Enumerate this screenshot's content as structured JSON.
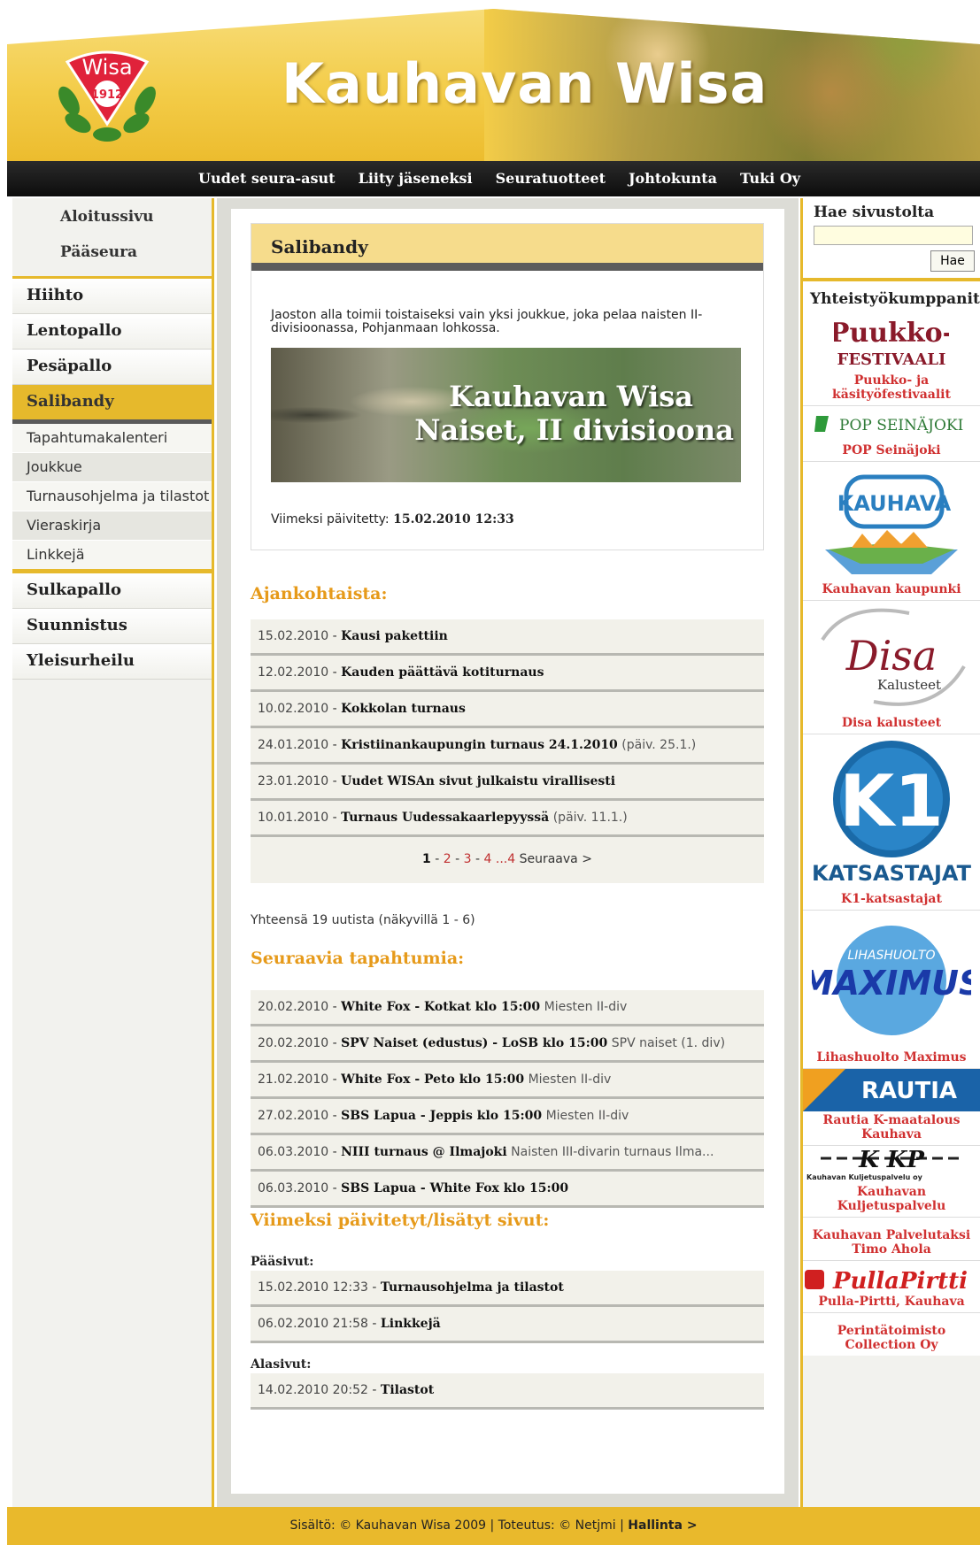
{
  "site": {
    "title": "Kauhavan Wisa",
    "logo_text": "Wisa",
    "logo_year": "1912"
  },
  "topnav": [
    "Uudet seura-asut",
    "Liity jäseneksi",
    "Seuratuotteet",
    "Johtokunta",
    "Tuki Oy"
  ],
  "left": {
    "main_links": [
      "Aloitussivu",
      "Pääseura"
    ],
    "sports_before": [
      "Hiihto",
      "Lentopallo",
      "Pesäpallo"
    ],
    "active_sport": "Salibandy",
    "subpages": [
      "Tapahtumakalenteri",
      "Joukkue",
      "Turnausohjelma ja tilastot",
      "Vieraskirja",
      "Linkkejä"
    ],
    "sports_after": [
      "Sulkapallo",
      "Suunnistus",
      "Yleisurheilu"
    ]
  },
  "main": {
    "page_title": "Salibandy",
    "intro": "Jaoston alla toimii toistaiseksi vain yksi joukkue, joka pelaa naisten II-divisioonassa, Pohjanmaan lohkossa.",
    "banner_line1": "Kauhavan Wisa",
    "banner_line2": "Naiset,  II divisioona",
    "updated_label": "Viimeksi päivitetty:",
    "updated_value": "15.02.2010 12:33",
    "news_title": "Ajankohtaista:",
    "news": [
      {
        "date": "15.02.2010",
        "title": "Kausi pakettiin",
        "extra": ""
      },
      {
        "date": "12.02.2010",
        "title": "Kauden päättävä kotiturnaus",
        "extra": ""
      },
      {
        "date": "10.02.2010",
        "title": "Kokkolan turnaus",
        "extra": ""
      },
      {
        "date": "24.01.2010",
        "title": "Kristiinankaupungin turnaus 24.1.2010",
        "extra": "(päiv. 25.1.)"
      },
      {
        "date": "23.01.2010",
        "title": "Uudet WISAn sivut julkaistu virallisesti",
        "extra": ""
      },
      {
        "date": "10.01.2010",
        "title": "Turnaus Uudessakaarlepyyssä",
        "extra": "(päiv. 11.1.)"
      }
    ],
    "pager": {
      "current": "1",
      "pages": [
        "2",
        "3",
        "4"
      ],
      "dots": "...4",
      "next": "Seuraava >"
    },
    "news_total": "Yhteensä 19 uutista (näkyvillä 1 - 6)",
    "events_title": "Seuraavia tapahtumia:",
    "events": [
      {
        "date": "20.02.2010",
        "title": "White Fox - Kotkat klo 15:00",
        "desc": "Miesten II-div"
      },
      {
        "date": "20.02.2010",
        "title": "SPV Naiset (edustus) - LoSB klo 15:00",
        "desc": "SPV naiset (1. div)"
      },
      {
        "date": "21.02.2010",
        "title": "White Fox - Peto klo 15:00",
        "desc": "Miesten II-div"
      },
      {
        "date": "27.02.2010",
        "title": "SBS Lapua - Jeppis klo 15:00",
        "desc": "Miesten II-div"
      },
      {
        "date": "06.03.2010",
        "title": "NIII turnaus @ Ilmajoki",
        "desc": "Naisten III-divarin turnaus Ilma..."
      },
      {
        "date": "06.03.2010",
        "title": "SBS Lapua - White Fox klo 15:00",
        "desc": ""
      }
    ],
    "updates_title": "Viimeksi päivitetyt/lisätyt sivut:",
    "main_pages_label": "Pääsivut:",
    "main_pages": [
      {
        "date": "15.02.2010 12:33",
        "title": "Turnausohjelma ja tilastot"
      },
      {
        "date": "06.02.2010 21:58",
        "title": "Linkkejä"
      }
    ],
    "sub_pages_label": "Alasivut:",
    "sub_pages": [
      {
        "date": "14.02.2010 20:52",
        "title": "Tilastot"
      }
    ]
  },
  "right": {
    "search_title": "Hae sivustolta",
    "search_button": "Hae",
    "partners_title": "Yhteistyökumppanit",
    "partners": [
      {
        "logo": "Puukko-Festivaali",
        "caption": "Puukko- ja käsityöfestivaalit"
      },
      {
        "logo": "POP SEINÄJOKI",
        "caption": "POP Seinäjoki"
      },
      {
        "logo": "KAUHAVA",
        "caption": "Kauhavan kaupunki"
      },
      {
        "logo": "Disa",
        "logo2": "Kalusteet",
        "caption": "Disa kalusteet"
      },
      {
        "logo": "K1",
        "logo2": "KATSASTAJAT",
        "caption": "K1-katsastajat"
      },
      {
        "logo": "MAXIMUS",
        "logo2": "LIHASHUOLTO",
        "caption": "Lihashuolto Maximus"
      },
      {
        "logo": "RAUTIA",
        "caption": "Rautia K-maatalous Kauhava"
      },
      {
        "logo": "K KP",
        "logo2": "Kauhavan Kuljetuspalvelu oy",
        "caption": "Kauhavan Kuljetuspalvelu"
      },
      {
        "logo": "",
        "caption": "Kauhavan Palvelutaksi Timo Ahola"
      },
      {
        "logo": "PullaPirtti",
        "caption": "Pulla-Pirtti, Kauhava"
      },
      {
        "logo": "",
        "caption": "Perintätoimisto Collection Oy"
      }
    ]
  },
  "footer": {
    "content": "Sisältö: © Kauhavan Wisa 2009 | Toteutus: © Netjmi |",
    "admin": "Hallinta >"
  },
  "colors": {
    "gold": "#e6b92c",
    "accent_orange": "#e69a1a",
    "link_red": "#c03030",
    "nav_bg": "#111111"
  }
}
